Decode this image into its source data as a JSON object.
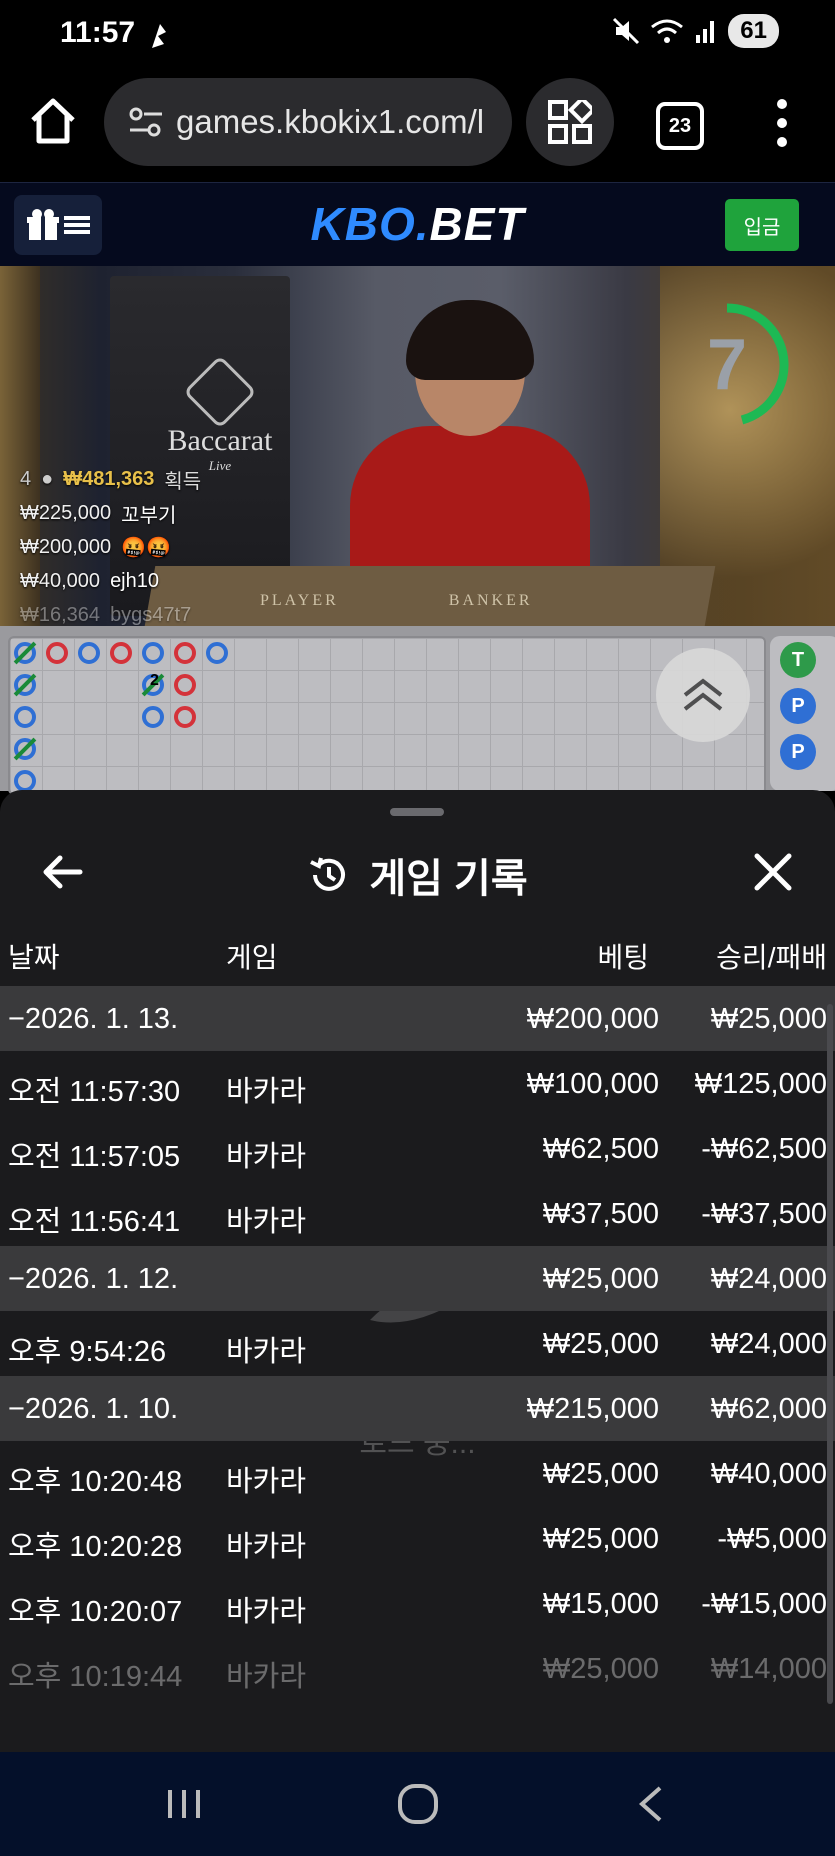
{
  "status_bar": {
    "time": "11:57",
    "battery": "61"
  },
  "browser": {
    "url": "games.kbokix1.com/l",
    "tab_count": "23"
  },
  "site": {
    "logo_kbo": "KBO.",
    "logo_bet": "BET",
    "deposit_label": "입금"
  },
  "video": {
    "game_logo": "Baccarat",
    "game_logo_sub": "Live",
    "table_player": "PLAYER",
    "table_banker": "BANKER",
    "timer": "7",
    "win_summary": {
      "count": "4",
      "amount": "₩481,363",
      "label": "획득"
    },
    "win_feed": [
      {
        "amount": "₩225,000",
        "user": "꼬부기"
      },
      {
        "amount": "₩200,000",
        "user": "🤬🤬"
      },
      {
        "amount": "₩40,000",
        "user": "ejh10"
      },
      {
        "amount": "₩16,364",
        "user": "bygs47t7"
      }
    ]
  },
  "road": {
    "bead_mark": "2",
    "side_badges": [
      "T",
      "P",
      "P"
    ]
  },
  "history": {
    "title": "게임 기록",
    "columns": {
      "date": "날짜",
      "game": "게임",
      "bet": "베팅",
      "result": "승리/패배"
    },
    "loading_text": "로드 중...",
    "rows": [
      {
        "type": "group",
        "date": "−2026. 1. 13.",
        "game": "",
        "bet": "₩200,000",
        "result": "₩25,000"
      },
      {
        "type": "item",
        "date": "오전 11:57:30",
        "game": "바카라",
        "bet": "₩100,000",
        "result": "₩125,000"
      },
      {
        "type": "item",
        "date": "오전 11:57:05",
        "game": "바카라",
        "bet": "₩62,500",
        "result": "-₩62,500"
      },
      {
        "type": "item",
        "date": "오전 11:56:41",
        "game": "바카라",
        "bet": "₩37,500",
        "result": "-₩37,500"
      },
      {
        "type": "group",
        "date": "−2026. 1. 12.",
        "game": "",
        "bet": "₩25,000",
        "result": "₩24,000"
      },
      {
        "type": "item",
        "date": "오후 9:54:26",
        "game": "바카라",
        "bet": "₩25,000",
        "result": "₩24,000"
      },
      {
        "type": "group",
        "date": "−2026. 1. 10.",
        "game": "",
        "bet": "₩215,000",
        "result": "₩62,000"
      },
      {
        "type": "item",
        "date": "오후 10:20:48",
        "game": "바카라",
        "bet": "₩25,000",
        "result": "₩40,000"
      },
      {
        "type": "item",
        "date": "오후 10:20:28",
        "game": "바카라",
        "bet": "₩25,000",
        "result": "-₩5,000"
      },
      {
        "type": "item",
        "date": "오후 10:20:07",
        "game": "바카라",
        "bet": "₩15,000",
        "result": "-₩15,000"
      },
      {
        "type": "item",
        "date": "오후 10:19:44",
        "game": "바카라",
        "bet": "₩25,000",
        "result": "₩14,000"
      }
    ]
  },
  "colors": {
    "accent_blue": "#2f8bff",
    "deposit_green": "#1fa33c",
    "timer_green": "#1db954"
  }
}
